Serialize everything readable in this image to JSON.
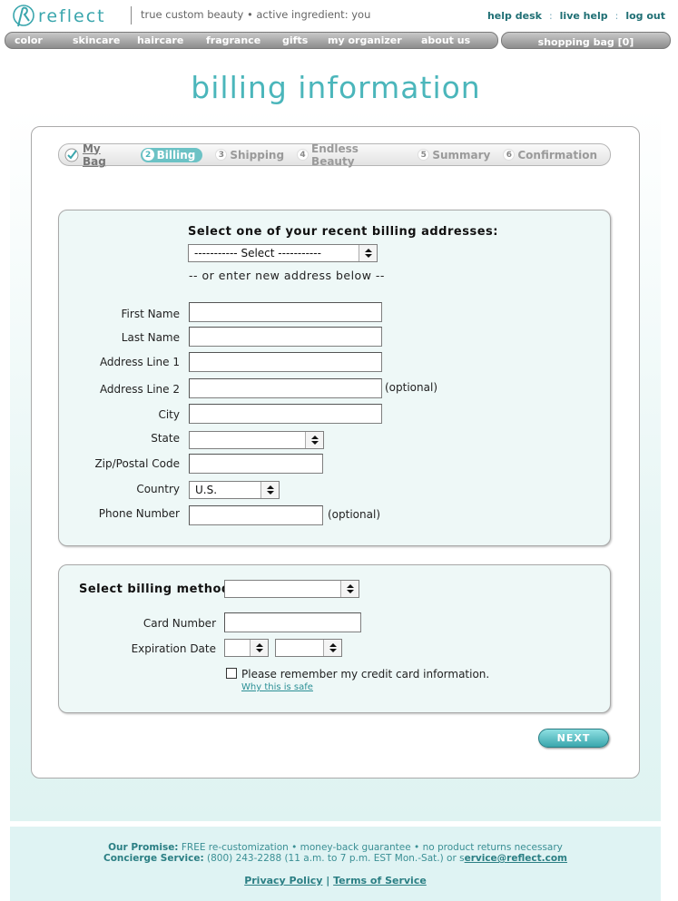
{
  "header": {
    "brand": "reflect",
    "tagline": "true custom beauty • active ingredient: you",
    "links": [
      "help desk",
      "live help",
      "log out"
    ],
    "link_separator": ":"
  },
  "nav": {
    "items": [
      "color",
      "skincare",
      "haircare",
      "fragrance",
      "gifts",
      "my organizer",
      "about us"
    ],
    "bag": "shopping bag [0]"
  },
  "page": {
    "title": "billing information"
  },
  "steps": [
    {
      "label": "My Bag",
      "state": "done"
    },
    {
      "num": "2",
      "label": "Billing",
      "state": "active"
    },
    {
      "num": "3",
      "label": "Shipping",
      "state": "pending"
    },
    {
      "num": "4",
      "label": "Endless Beauty",
      "state": "pending"
    },
    {
      "num": "5",
      "label": "Summary",
      "state": "pending"
    },
    {
      "num": "6",
      "label": "Confirmation",
      "state": "pending"
    }
  ],
  "address": {
    "recent_heading": "Select one of your recent billing addresses:",
    "recent_select": "----------- Select -----------",
    "or_text": "-- or enter new address below --",
    "labels": {
      "first_name": "First Name",
      "last_name": "Last Name",
      "address1": "Address Line 1",
      "address2": "Address Line 2",
      "city": "City",
      "state": "State",
      "zip": "Zip/Postal Code",
      "country": "Country",
      "phone": "Phone Number"
    },
    "optional": "(optional)",
    "country_value": "U.S.",
    "state_value": ""
  },
  "billing": {
    "method_label": "Select billing method:",
    "method_value": "",
    "card_label": "Card Number",
    "exp_label": "Expiration Date",
    "remember": "Please remember my credit card information.",
    "why_safe": "Why this is safe"
  },
  "next_label": "NEXT",
  "footer": {
    "promise_label": "Our Promise:",
    "promise_text": "FREE re-customization • money-back guarantee • no product returns necessary",
    "concierge_label": "Concierge Service:",
    "concierge_text": "(800) 243-2288 (11 a.m. to 7 p.m. EST Mon.-Sat.) or s",
    "email": "ervice@reflect.com",
    "privacy": "Privacy Policy",
    "sep": "|",
    "terms": "Terms of Service"
  },
  "colors": {
    "accent": "#4bb6bb",
    "panel": "#eef8f7",
    "nav": "#9e9e9e"
  }
}
